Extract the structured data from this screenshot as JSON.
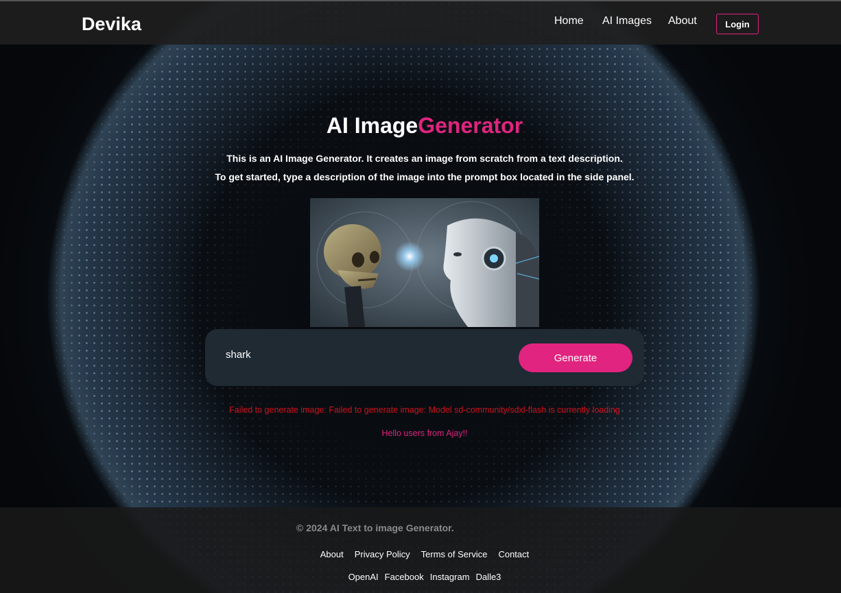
{
  "navbar": {
    "brand": "Devika",
    "links": [
      {
        "label": "Home"
      },
      {
        "label": "AI Images"
      },
      {
        "label": "About"
      }
    ],
    "login_label": "Login"
  },
  "hero": {
    "title_main": "AI Image",
    "title_accent": "Generator",
    "description_line1": "This is an AI Image Generator. It creates an image from scratch from a text description.",
    "description_line2": "To get started, type a description of the image into the prompt box located in the side panel."
  },
  "prompt": {
    "value": "shark",
    "generate_label": "Generate"
  },
  "messages": {
    "error": "Failed to generate image: Failed to generate image: Model sd-community/sdxl-flash is currently loading",
    "hello": "Hello users from Ajay!!"
  },
  "footer": {
    "copyright": "© 2024 AI Text to image Generator.",
    "links_row1": [
      {
        "label": "About"
      },
      {
        "label": "Privacy Policy"
      },
      {
        "label": "Terms of Service"
      },
      {
        "label": "Contact"
      }
    ],
    "links_row2": [
      {
        "label": "OpenAI"
      },
      {
        "label": "Facebook"
      },
      {
        "label": "Instagram"
      },
      {
        "label": "Dalle3"
      }
    ]
  },
  "colors": {
    "accent": "#e0247f",
    "error": "#d0121f",
    "navbar_bg": "#1e1e1e",
    "prompt_bg": "#1f2a33"
  }
}
